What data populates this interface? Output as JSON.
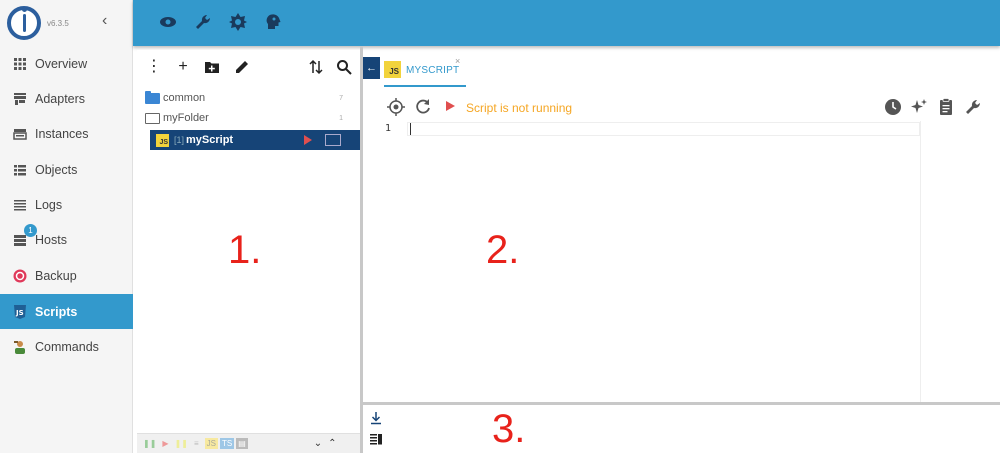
{
  "app": {
    "version": "v6.3.5"
  },
  "sidebar": {
    "items": [
      {
        "label": "Overview",
        "icon": "grid-icon"
      },
      {
        "label": "Adapters",
        "icon": "store-icon"
      },
      {
        "label": "Instances",
        "icon": "instances-icon"
      },
      {
        "label": "Objects",
        "icon": "list-icon"
      },
      {
        "label": "Logs",
        "icon": "lines-icon"
      },
      {
        "label": "Hosts",
        "icon": "hosts-icon",
        "badge": "1"
      },
      {
        "label": "Backup",
        "icon": "backup-icon"
      },
      {
        "label": "Scripts",
        "icon": "js-icon",
        "active": true
      },
      {
        "label": "Commands",
        "icon": "person-icon"
      }
    ]
  },
  "topbar": {
    "icons": [
      "eye-icon",
      "wrench-icon",
      "brightness-icon",
      "head-icon"
    ]
  },
  "tree": {
    "rows": [
      {
        "label": "common",
        "count": "7"
      },
      {
        "label": "myFolder",
        "count": "1"
      }
    ],
    "script": {
      "instance": "[1]",
      "name": "myScript"
    }
  },
  "editor": {
    "tab_label": "MYSCRIPT",
    "tab_close": "×",
    "status": "Script is not running",
    "line_number": "1"
  },
  "annotations": {
    "one": "1.",
    "two": "2.",
    "three": "3."
  },
  "colors": {
    "accent": "#3399cc",
    "selection": "#164477",
    "status_warning": "#f5a623",
    "annotation": "#e8221b"
  }
}
